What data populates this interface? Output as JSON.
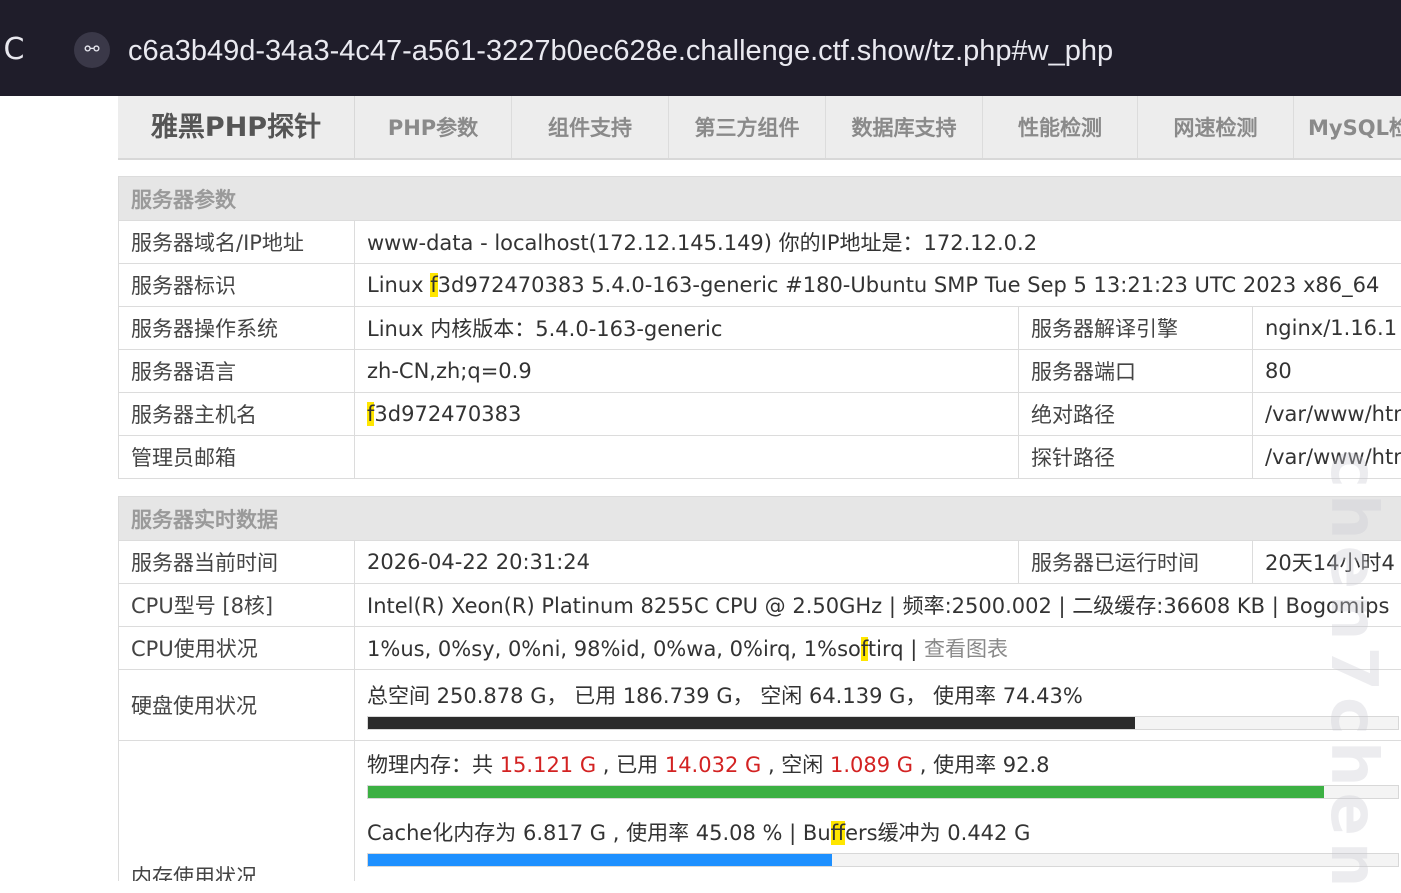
{
  "browser": {
    "reload_glyph": "C",
    "site_info_glyph": "⚯",
    "url": "c6a3b49d-34a3-4c47-a561-3227b0ec628e.challenge.ctf.show/tz.php#w_php"
  },
  "nav": {
    "brand": "雅黑PHP探针",
    "items": [
      "PHP参数",
      "组件支持",
      "第三方组件",
      "数据库支持",
      "性能检测",
      "网速检测",
      "MySQL检"
    ]
  },
  "server_params": {
    "section_title": "服务器参数",
    "domain_label": "服务器域名/IP地址",
    "domain_value": "www-data - localhost(172.12.145.149)  你的IP地址是：172.12.0.2",
    "ident_label": "服务器标识",
    "ident_prefix": "Linux ",
    "ident_hl": "f",
    "ident_rest": "3d972470383 5.4.0-163-generic #180-Ubuntu SMP Tue Sep 5 13:21:23 UTC 2023 x86_64",
    "os_label": "服务器操作系统",
    "os_value": "Linux  内核版本：5.4.0-163-generic",
    "engine_label": "服务器解译引擎",
    "engine_value": "nginx/1.16.1",
    "lang_label": "服务器语言",
    "lang_value": "zh-CN,zh;q=0.9",
    "port_label": "服务器端口",
    "port_value": "80",
    "host_label": "服务器主机名",
    "host_hl": "f",
    "host_rest": "3d972470383",
    "abs_path_label": "绝对路径",
    "abs_path_value": "/var/www/html",
    "admin_label": "管理员邮箱",
    "admin_value": "",
    "probe_path_label": "探针路径",
    "probe_path_value": "/var/www/html"
  },
  "realtime": {
    "section_title": "服务器实时数据",
    "time_label": "服务器当前时间",
    "time_value": "2026-04-22 20:31:24",
    "uptime_label": "服务器已运行时间",
    "uptime_value": "20天14小时4",
    "cpu_model_label": "CPU型号 [8核]",
    "cpu_model_value": "Intel(R) Xeon(R) Platinum 8255C CPU @ 2.50GHz | 频率:2500.002 | 二级缓存:36608 KB | Bogomips",
    "cpu_usage_label": "CPU使用状况",
    "cpu_usage_pre": "1%us, 0%sy, 0%ni, 98%id, 0%wa, 0%irq, 1%so",
    "cpu_usage_hl": "f",
    "cpu_usage_post": "tirq | ",
    "cpu_chart_link": "查看图表",
    "disk_label": "硬盘使用状况",
    "disk_text": "总空间 250.878 G，  已用 186.739 G，  空闲 64.139 G，  使用率 74.43%",
    "disk_percent": 74.43,
    "disk_bar_color": "#2b2b2b",
    "mem_label": "内存使用状况",
    "mem_phys_prefix": "物理内存：共 ",
    "mem_total": "15.121 G",
    "mem_used_prefix": " , 已用 ",
    "mem_used": "14.032 G",
    "mem_free_prefix": " , 空闲 ",
    "mem_free": "1.089 G",
    "mem_rate": " , 使用率 92.8",
    "mem_percent": 92.8,
    "mem_bar_color": "#3cb043",
    "cache_pre": "Cache化内存为 6.817 G , 使用率 45.08 % | Bu",
    "cache_hl": "ff",
    "cache_post": "ers缓冲为 0.442 G",
    "cache_percent": 45.08,
    "cache_bar_color": "#1e90ff"
  },
  "watermark": "chen7chen"
}
